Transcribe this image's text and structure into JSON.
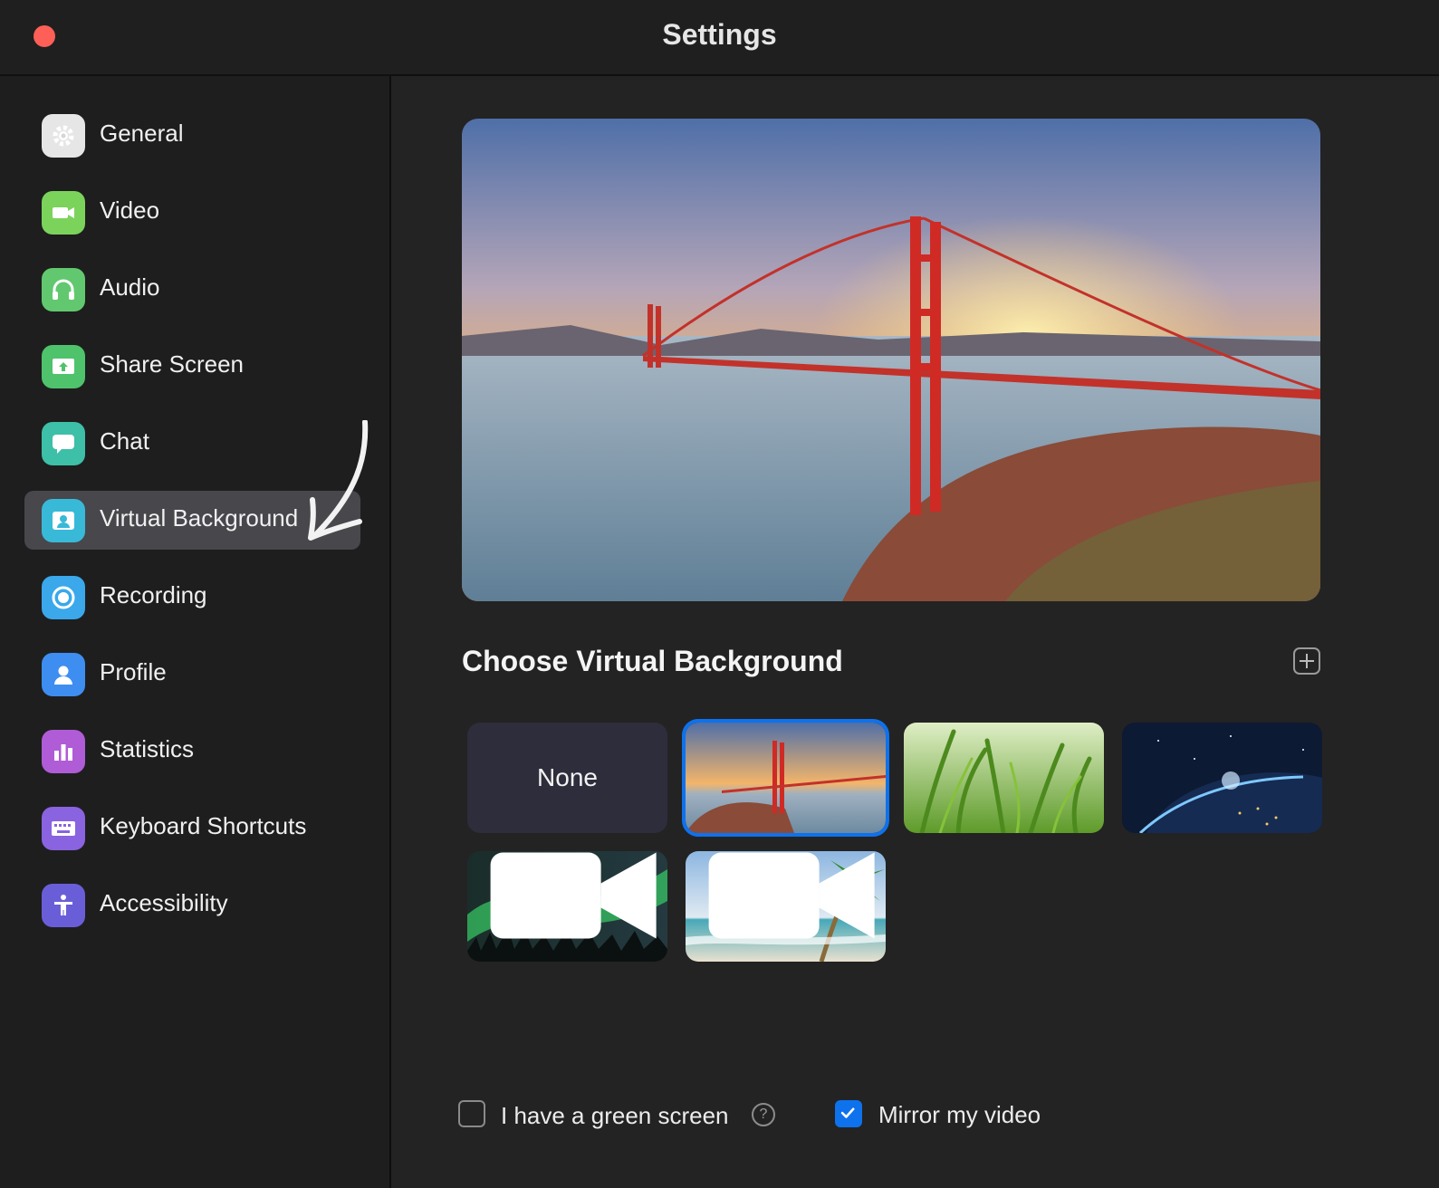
{
  "window": {
    "title": "Settings"
  },
  "sidebar": {
    "items": [
      {
        "label": "General",
        "icon": "gear-icon",
        "color": "#e8e8e8",
        "selected": false
      },
      {
        "label": "Video",
        "icon": "video-camera-icon",
        "color": "#7bd35b",
        "selected": false
      },
      {
        "label": "Audio",
        "icon": "headphones-icon",
        "color": "#62c86f",
        "selected": false
      },
      {
        "label": "Share Screen",
        "icon": "share-screen-icon",
        "color": "#4fc26c",
        "selected": false
      },
      {
        "label": "Chat",
        "icon": "chat-bubble-icon",
        "color": "#3dbfa8",
        "selected": false
      },
      {
        "label": "Virtual Background",
        "icon": "person-card-icon",
        "color": "#39b9d8",
        "selected": true
      },
      {
        "label": "Recording",
        "icon": "record-icon",
        "color": "#3aa8ea",
        "selected": false
      },
      {
        "label": "Profile",
        "icon": "person-icon",
        "color": "#3d8ef0",
        "selected": false
      },
      {
        "label": "Statistics",
        "icon": "bar-chart-icon",
        "color": "#b05cd6",
        "selected": false
      },
      {
        "label": "Keyboard Shortcuts",
        "icon": "keyboard-icon",
        "color": "#8a63e0",
        "selected": false
      },
      {
        "label": "Accessibility",
        "icon": "accessibility-icon",
        "color": "#6a5ed8",
        "selected": false
      }
    ]
  },
  "main": {
    "section_title": "Choose Virtual Background",
    "add_button": "plus-icon",
    "backgrounds": {
      "none_label": "None",
      "selected": "Golden Gate Bridge",
      "thumbs": [
        "None",
        "Golden Gate Bridge",
        "Grass",
        "Earth from space",
        "Aurora",
        "Beach palm"
      ]
    },
    "options": {
      "green_screen_label": "I have a green screen",
      "green_screen_checked": false,
      "mirror_label": "Mirror my video",
      "mirror_checked": true
    }
  },
  "colors": {
    "accent": "#0e72ed",
    "close": "#fe5f57",
    "selected_nav": "#47474c"
  }
}
